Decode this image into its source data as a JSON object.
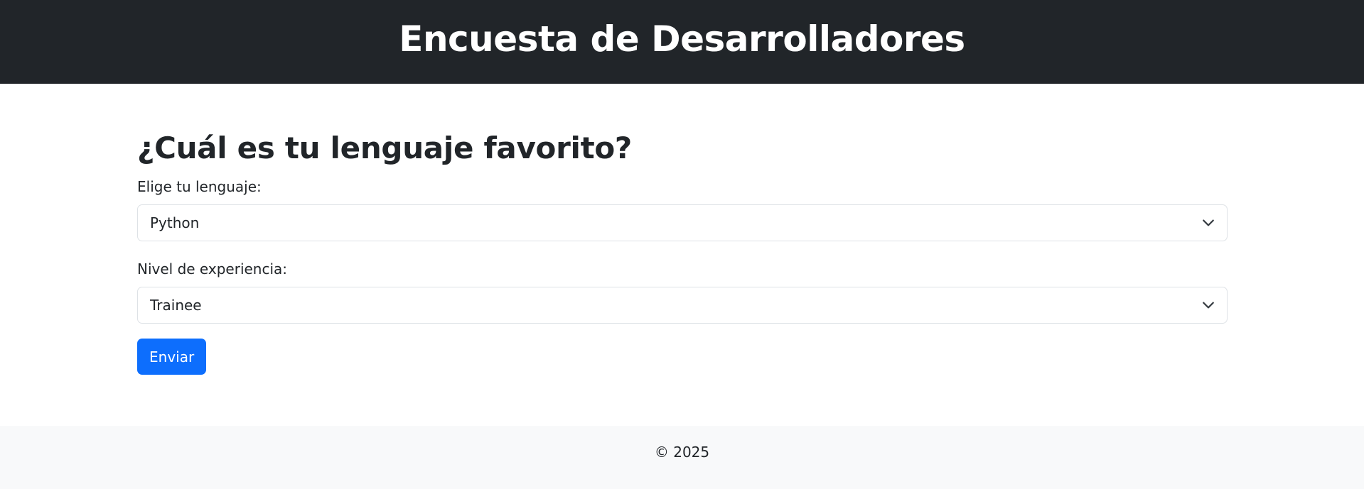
{
  "header": {
    "title": "Encuesta de Desarrolladores"
  },
  "survey": {
    "question": "¿Cuál es tu lenguaje favorito?",
    "language_label": "Elige tu lenguaje:",
    "language_value": "Python",
    "experience_label": "Nivel de experiencia:",
    "experience_value": "Trainee",
    "submit_label": "Enviar"
  },
  "footer": {
    "text": "© 2025"
  },
  "colors": {
    "header_bg": "#212529",
    "primary": "#0d6efd",
    "footer_bg": "#f8f9fa",
    "border": "#dee2e6"
  },
  "icons": {
    "select_arrow": "chevron-down-icon"
  }
}
